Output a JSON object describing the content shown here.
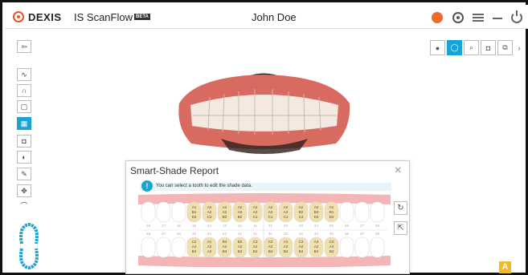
{
  "app": {
    "brand": "DEXIS",
    "product": "IS ScanFlow",
    "beta": "BETA",
    "patient_name": "John Doe"
  },
  "panel": {
    "title": "Smart-Shade Report",
    "info_icon": "!",
    "info_text": "You can select a tooth to edit the shade data."
  },
  "upper_shades": [
    [
      "A1",
      "B1",
      "D2"
    ],
    [
      "A2",
      "A2",
      "C3"
    ],
    [
      "A2",
      "A2",
      "B2"
    ],
    [
      "A2",
      "A2",
      "B2"
    ],
    [
      "A2",
      "A2",
      "C1"
    ],
    [
      "A2",
      "A2",
      "C1"
    ],
    [
      "A2",
      "A2",
      "C1"
    ],
    [
      "A2",
      "B2",
      "C4"
    ],
    [
      "A2",
      "B3",
      "D4"
    ],
    [
      "A1",
      "B1",
      "D2"
    ]
  ],
  "lower_shades": [
    [
      "C2",
      "A4",
      "B4"
    ],
    [
      "A1",
      "A2",
      "A2"
    ],
    [
      "B3",
      "A2",
      "B3"
    ],
    [
      "B3",
      "A2",
      "B4"
    ],
    [
      "C3",
      "A2",
      "B4"
    ],
    [
      "C2",
      "A2",
      "B4"
    ],
    [
      "A1",
      "A2",
      "B4"
    ],
    [
      "C3",
      "A2",
      "B4"
    ],
    [
      "A3",
      "A2",
      "B4"
    ],
    [
      "C3",
      "A4",
      "B4"
    ]
  ],
  "upper_numbers": [
    "18",
    "17",
    "16",
    "15",
    "14",
    "13",
    "12",
    "11",
    "21",
    "22",
    "23",
    "24",
    "25",
    "26",
    "27",
    "28"
  ],
  "lower_numbers": [
    "48",
    "47",
    "46",
    "45",
    "44",
    "43",
    "42",
    "41",
    "31",
    "32",
    "33",
    "34",
    "35",
    "36",
    "37",
    "38"
  ],
  "shade_badge": "A",
  "colors": {
    "accent": "#1aa4d6",
    "record": "#f06a2b",
    "gum": "#f3b5b5",
    "shaded_tooth": "#efe0b0",
    "badge": "#f2b92c"
  }
}
